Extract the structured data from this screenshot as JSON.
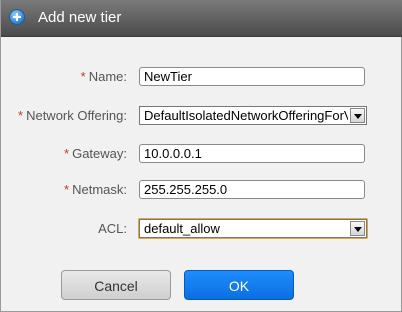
{
  "dialog": {
    "title": "Add new tier",
    "icon": "add-circle-icon"
  },
  "form": {
    "required_mark": "*",
    "name": {
      "label": "Name:",
      "value": "NewTier"
    },
    "network_offering": {
      "label": "Network Offering:",
      "value": "DefaultIsolatedNetworkOfferingForV"
    },
    "gateway": {
      "label": "Gateway:",
      "value": "10.0.0.0.1"
    },
    "netmask": {
      "label": "Netmask:",
      "value": "255.255.255.0"
    },
    "acl": {
      "label": "ACL:",
      "value": "default_allow"
    }
  },
  "buttons": {
    "cancel": "Cancel",
    "ok": "OK"
  },
  "colors": {
    "primary": "#0b6fe0",
    "required": "#c0392b",
    "focus": "#e0a83a"
  }
}
